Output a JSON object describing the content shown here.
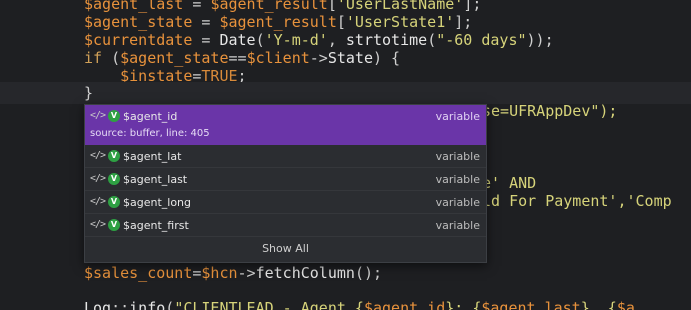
{
  "code": {
    "l1": {
      "a": "$agent_last",
      "b": " = ",
      "c": "$agent_result",
      "d": "[",
      "e": "'UserLastName'",
      "f": "];"
    },
    "l2": {
      "a": "$agent_state",
      "b": " = ",
      "c": "$agent_result",
      "d": "[",
      "e": "'UserState1'",
      "f": "];"
    },
    "l3": {
      "a": "$currentdate",
      "b": " = ",
      "c": "Date",
      "d": "(",
      "e": "'Y-m-d'",
      "f": ", ",
      "g": "strtotime",
      "h": "(",
      "i": "\"-60 days\"",
      "j": "));"
    },
    "l4": {
      "a": "if",
      "b": " (",
      "c": "$agent_state",
      "d": "==",
      "e": "$client",
      "f": "->",
      "g": "State",
      "h": ") {"
    },
    "l5": {
      "a": "    $instate",
      "b": "=",
      "c": "TRUE",
      "d": ";"
    },
    "l6": {
      "a": "}"
    },
    "l7": {
      "a": "se=UFRAppDev\");"
    },
    "l8": {
      "a": "e' AND"
    },
    "l9": {
      "a": "ld For Payment','Comp"
    },
    "l10": {
      "a": "$sales_count",
      "b": "=",
      "c": "$hcn",
      "d": "->",
      "e": "fetchColumn",
      "f": "();"
    },
    "l11": {
      "a": "Log",
      "b": "::",
      "c": "info",
      "d": "(",
      "e": "\"CLIENTLEAD - Agent {",
      "f": "$agent_id",
      "g": "}: {",
      "h": "$agent_last",
      "i": "}  {",
      "j": "$a"
    }
  },
  "autocomplete": {
    "code_icon": "code-icon",
    "variable_badge": "V",
    "items": [
      {
        "label": "$agent_id",
        "kind": "variable",
        "source": "source: buffer, line: 405"
      },
      {
        "label": "$agent_lat",
        "kind": "variable"
      },
      {
        "label": "$agent_last",
        "kind": "variable"
      },
      {
        "label": "$agent_long",
        "kind": "variable"
      },
      {
        "label": "$agent_first",
        "kind": "variable"
      }
    ],
    "show_all": "Show All"
  },
  "colors": {
    "editor_bg": "#1e1f22",
    "variable": "#e8923c",
    "string": "#d6d37a",
    "selection": "#6a35a8",
    "badge": "#2ea043"
  }
}
